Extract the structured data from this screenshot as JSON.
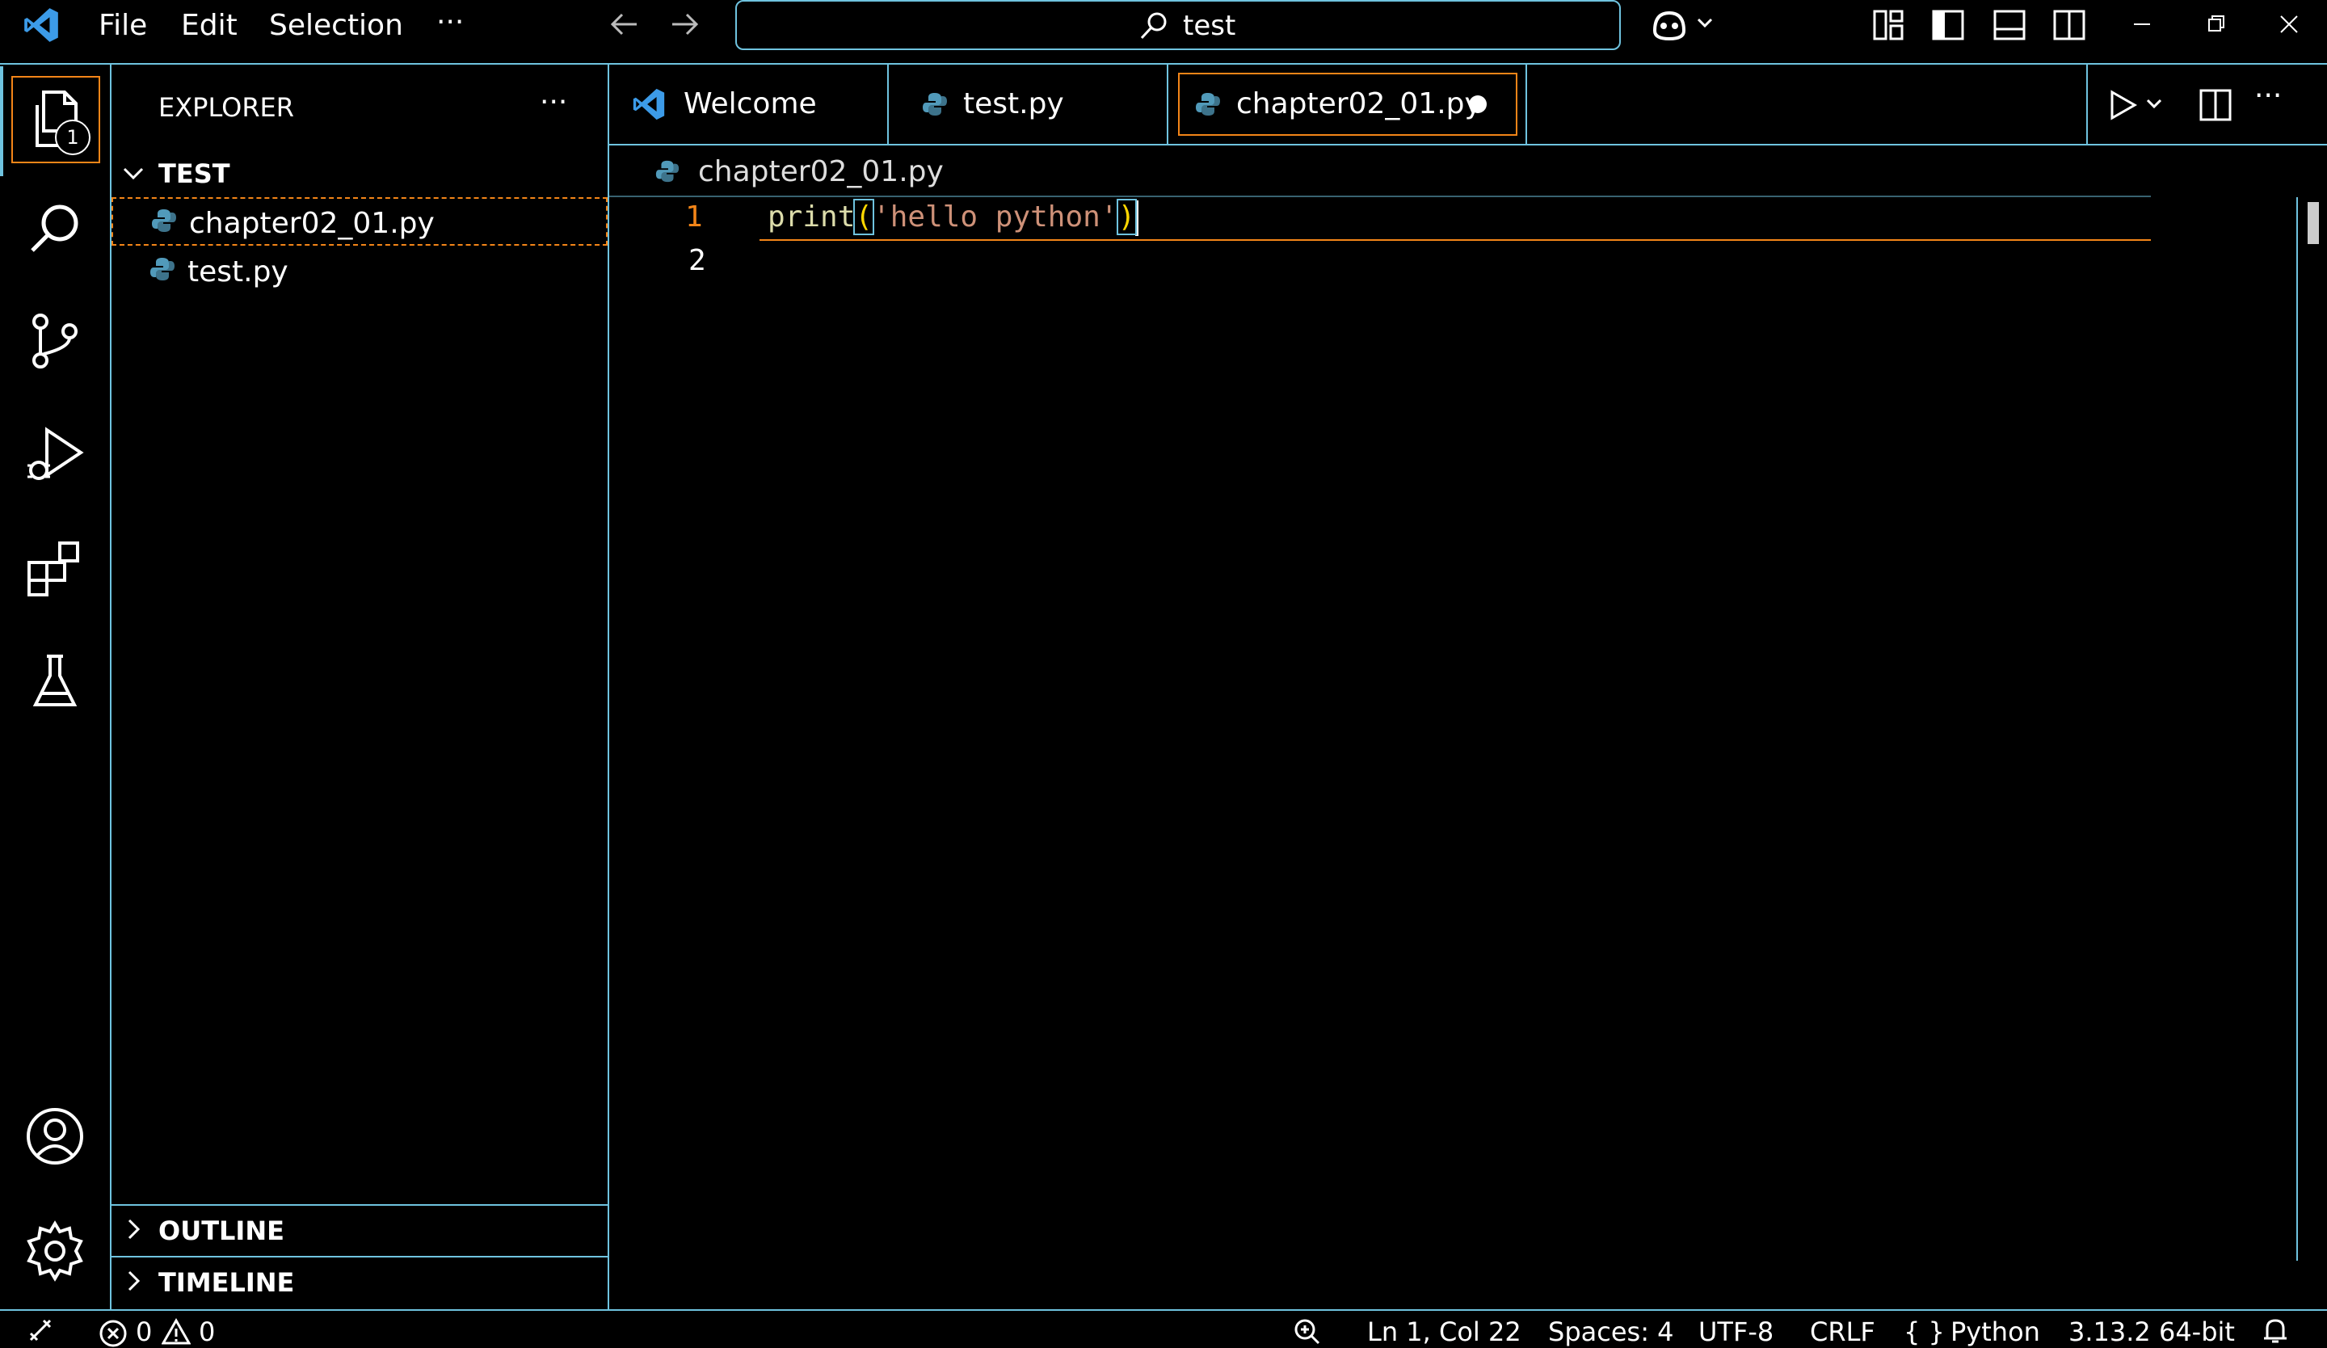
{
  "titlebar": {
    "menu": [
      "File",
      "Edit",
      "Selection"
    ],
    "more": "···",
    "search_text": "test"
  },
  "activitybar": {
    "explorer_badge": "1"
  },
  "sidebar": {
    "title": "EXPLORER",
    "more": "···",
    "folder": "TEST",
    "files": [
      "chapter02_01.py",
      "test.py"
    ],
    "outline": "OUTLINE",
    "timeline": "TIMELINE"
  },
  "tabs": [
    {
      "label": "Welcome"
    },
    {
      "label": "test.py"
    },
    {
      "label": "chapter02_01.py"
    }
  ],
  "editor": {
    "breadcrumb": "chapter02_01.py",
    "line_numbers": [
      "1",
      "2"
    ],
    "code": {
      "fn": "print",
      "open": "(",
      "str": "'hello python'",
      "close": ")"
    }
  },
  "statusbar": {
    "errors": "0",
    "warnings": "0",
    "position": "Ln 1, Col 22",
    "spaces": "Spaces: 4",
    "encoding": "UTF-8",
    "eol": "CRLF",
    "braces": "{ }",
    "language": "Python",
    "interpreter": "3.13.2 64-bit"
  },
  "colors": {
    "border": "#6fc3df",
    "active": "#f38518",
    "string": "#ce9178",
    "function": "#dcdcaa",
    "bracket": "#ffd700",
    "python": "#519aba",
    "vscode": "#3c9be8"
  }
}
